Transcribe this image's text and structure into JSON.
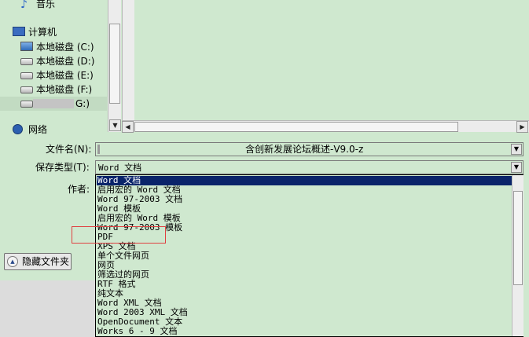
{
  "nav": {
    "music": "音乐",
    "computer": "计算机",
    "drives": [
      {
        "label": "本地磁盘 (C:)"
      },
      {
        "label": "本地磁盘 (D:)"
      },
      {
        "label": "本地磁盘 (E:)"
      },
      {
        "label": "本地磁盘 (F:)"
      },
      {
        "label": "G:)"
      }
    ],
    "network": "网络"
  },
  "form": {
    "filename_label": "文件名(N):",
    "filename_value": "含创新发展论坛概述-V9.0-z",
    "filetype_label": "保存类型(T):",
    "filetype_value": "Word 文档",
    "author_label": "作者:"
  },
  "hide_folders_label": "隐藏文件夹",
  "filetype_options": [
    "Word 文档",
    "启用宏的 Word 文档",
    "Word 97-2003 文档",
    "Word 模板",
    "启用宏的 Word 模板",
    "Word 97-2003 模板",
    "PDF",
    "XPS 文档",
    "单个文件网页",
    "网页",
    "筛选过的网页",
    "RTF 格式",
    "纯文本",
    "Word XML 文档",
    "Word 2003 XML 文档",
    "OpenDocument 文本",
    "Works 6 - 9 文档"
  ],
  "selected_index": 0,
  "colors": {
    "background": "#cfe8cf",
    "selection": "#0a246a",
    "annotation": "#e04040"
  }
}
